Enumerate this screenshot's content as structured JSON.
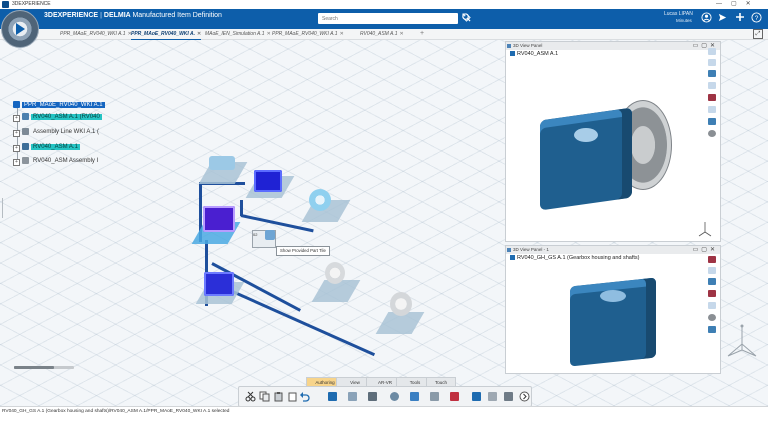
{
  "window": {
    "title": "3DEXPERIENCE"
  },
  "header": {
    "brand": "3DEXPERIENCE",
    "sep": "|",
    "brand_product": "DELMIA",
    "app_name": "Manufactured Item Definition",
    "search_placeholder": "Search",
    "user_name": "Lucas LIPAN",
    "user_sub": "Minutes"
  },
  "tabs": [
    {
      "label": "PPR_MAoE_RV040_WKI A.1"
    },
    {
      "label": "PPR_MAoE_RV040_WKI A.",
      "active": true
    },
    {
      "label": "MAoE_IEN_Simulation A.1"
    },
    {
      "label": "PPR_MAoE_RV040_WKI A.1"
    },
    {
      "label": "RV040_ASM A.1"
    }
  ],
  "tree": [
    {
      "label": "PPR_MAoE_RV040_WKI A.1",
      "style": "sel"
    },
    {
      "label": "RV040_ASM A.1 (RV040",
      "style": "teal"
    },
    {
      "label": "Assembly Line WKI A.1 (",
      "style": "plain"
    },
    {
      "label": "RV040_ASM A.1",
      "style": "teal"
    },
    {
      "label": "RV040_ASM Assembly I",
      "style": "plain"
    }
  ],
  "canvas": {
    "tooltip": "Show Provided Part Tile",
    "small_badge": "02"
  },
  "panel_top": {
    "title": "3D View Panel",
    "subtitle": "RV040_ASM A.1"
  },
  "panel_bottom": {
    "title": "3D View Panel - 1",
    "subtitle": "RV040_GH_GS A.1 (Gearbox housing and shafts)"
  },
  "toolbar_tabs": [
    {
      "label": "Authoring",
      "active": true
    },
    {
      "label": "View"
    },
    {
      "label": "AR-VR"
    },
    {
      "label": "Tools"
    },
    {
      "label": "Touch"
    }
  ],
  "status_text": "RV040_GH_GS A.1 (Gearbox housing and shafts)/RV040_ASM A.1/PPR_MAoE_RV040_WKI A.1 selected",
  "colors": {
    "header": "#0d5eaa",
    "selection": "#1565c0",
    "teal": "#25c3c3",
    "gear_blue": "#1f5f8f"
  },
  "icons": [
    "compass-icon",
    "search-icon",
    "tag-icon",
    "user-icon",
    "share-icon",
    "add-icon",
    "help-icon",
    "expand-icon"
  ]
}
